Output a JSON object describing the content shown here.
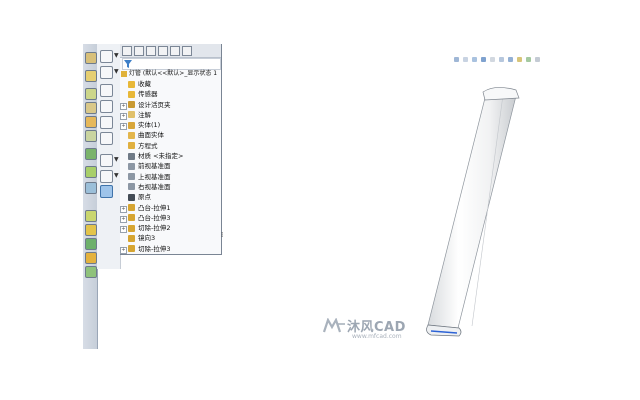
{
  "feature_tree": {
    "root_label": "灯管 (默认<<默认>_显示状态 1",
    "items": [
      {
        "label": "收藏",
        "expandable": false,
        "icon": "folder-icon",
        "color": "#e8b838"
      },
      {
        "label": "传感器",
        "expandable": false,
        "icon": "sensor-icon",
        "color": "#e8b838"
      },
      {
        "label": "设计活页夹",
        "expandable": true,
        "icon": "design-binder-icon",
        "color": "#c99a32"
      },
      {
        "label": "注解",
        "expandable": true,
        "icon": "annotation-icon",
        "color": "#e0c06a"
      },
      {
        "label": "实体(1)",
        "expandable": true,
        "icon": "solid-bodies-icon",
        "color": "#d8a63a"
      },
      {
        "label": "曲面实体",
        "expandable": false,
        "icon": "surface-bodies-icon",
        "color": "#e3b64d"
      },
      {
        "label": "方程式",
        "expandable": false,
        "icon": "equations-icon",
        "color": "#e0b040"
      },
      {
        "label": "材质 <未指定>",
        "expandable": false,
        "icon": "material-icon",
        "color": "#6f7a86"
      },
      {
        "label": "前视基准面",
        "expandable": false,
        "icon": "plane-icon",
        "color": "#8c97a4"
      },
      {
        "label": "上视基准面",
        "expandable": false,
        "icon": "plane-icon",
        "color": "#8c97a4"
      },
      {
        "label": "右视基准面",
        "expandable": false,
        "icon": "plane-icon",
        "color": "#8c97a4"
      },
      {
        "label": "原点",
        "expandable": false,
        "icon": "origin-icon",
        "color": "#444c56"
      },
      {
        "label": "凸台-拉伸1",
        "expandable": true,
        "icon": "extrude-icon",
        "color": "#d6a532"
      },
      {
        "label": "凸台-拉伸3",
        "expandable": true,
        "icon": "extrude-icon",
        "color": "#d6a532"
      },
      {
        "label": "切除-拉伸2",
        "expandable": true,
        "icon": "cut-extrude-icon",
        "color": "#d6a532"
      },
      {
        "label": "镜向3",
        "expandable": false,
        "icon": "mirror-icon",
        "color": "#d6a532"
      },
      {
        "label": "切除-拉伸3",
        "expandable": true,
        "icon": "cut-extrude-icon",
        "color": "#d6a532"
      }
    ]
  },
  "left_toolbar": {
    "buttons": [
      "sketch-icon",
      "smart-dimension-icon",
      "extrude-icon",
      "revolve-icon",
      "sweep-icon",
      "loft-icon",
      "pattern-icon",
      "fillet-icon",
      "view-orientation-icon",
      "appearance-icon",
      "section-view-icon",
      "curves-icon",
      "reference-geometry-icon",
      "instant3d-icon"
    ]
  },
  "viewport": {
    "heads_up_icons": [
      "zoom-to-fit-icon",
      "zoom-area-icon",
      "previous-view-icon",
      "section-view-icon",
      "view-orientation-icon",
      "display-style-icon",
      "hide-show-icon",
      "edit-appearance-icon",
      "apply-scene-icon",
      "view-settings-icon"
    ],
    "model": "tube-light-part"
  },
  "watermark": {
    "brand": "沐风CAD",
    "url": "www.mfcad.com"
  },
  "colors": {
    "selection_blue": "#9ec4ea",
    "accent_blue": "#2d63d6"
  }
}
